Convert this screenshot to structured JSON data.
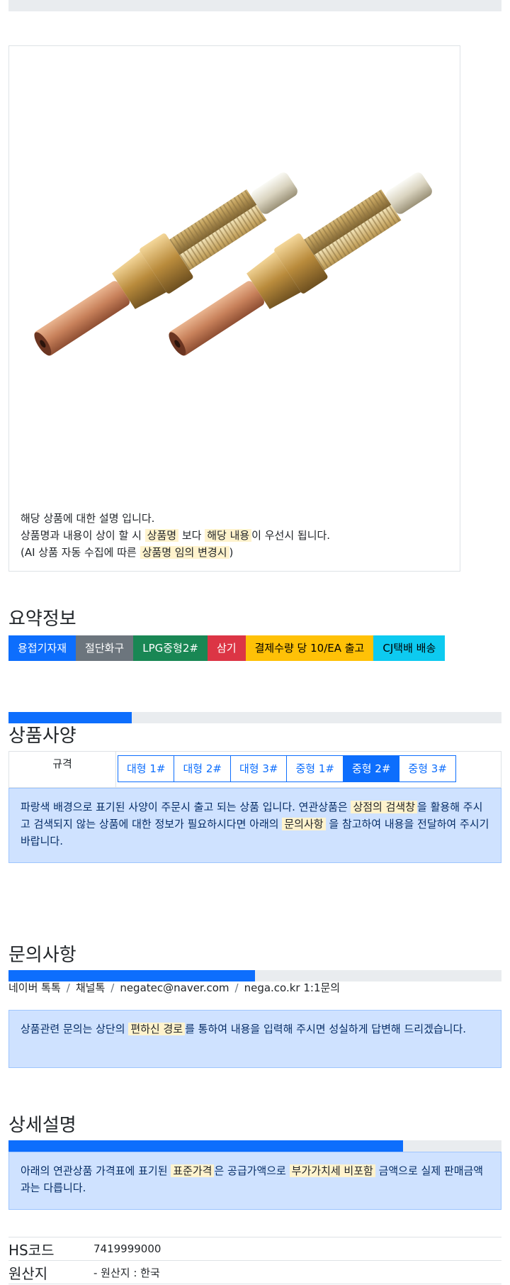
{
  "product": {
    "image_alt": "gas welding torch tips (2 pcs)",
    "description": {
      "line1": "해당 상품에 대한 설명 입니다.",
      "line2_a": "상품명과 내용이 상이 할 시 ",
      "line2_mark1": "상품명",
      "line2_b": " 보다 ",
      "line2_mark2": "해당 내용",
      "line2_c": "이 우선시 됩니다.",
      "line3_a": "(AI 상품 자동 수집에 따른 ",
      "line3_mark": "상품명 임의 변경시",
      "line3_b": ")"
    }
  },
  "summary": {
    "title": "요약정보",
    "badges": [
      {
        "label": "용접기자재",
        "color": "#0d6efd",
        "text_color": "#ffffff"
      },
      {
        "label": "절단화구",
        "color": "#6c757d",
        "text_color": "#ffffff"
      },
      {
        "label": "LPG중형2#",
        "color": "#198754",
        "text_color": "#ffffff"
      },
      {
        "label": "삼기",
        "color": "#dc3545",
        "text_color": "#ffffff"
      },
      {
        "label": "결제수량 당 10/EA 출고",
        "color": "#ffc107",
        "text_color": "#000000"
      },
      {
        "label": "CJ택배 배송",
        "color": "#0dcaf0",
        "text_color": "#000000"
      }
    ]
  },
  "spec": {
    "title": "상품사양",
    "progress": 0.25,
    "label": "규격",
    "options": [
      {
        "label": "대형 1#",
        "selected": false
      },
      {
        "label": "대형 2#",
        "selected": false
      },
      {
        "label": "대형 3#",
        "selected": false
      },
      {
        "label": "중형 1#",
        "selected": false
      },
      {
        "label": "중형 2#",
        "selected": true
      },
      {
        "label": "중형 3#",
        "selected": false
      }
    ],
    "notice": {
      "a": "파랑색 배경으로 표기된 사양이 주문시 출고 되는 상품 입니다. 연관상품은 ",
      "mark1": "상점의 검색창",
      "b": "을 활용해 주시고 검색되지 않는 상품에 대한 정보가 필요하시다면 아래의 ",
      "mark2": "문의사항",
      "c": " 을 참고하여 내용을 전달하여 주시기 바랍니다."
    }
  },
  "inquiry": {
    "title": "문의사항",
    "progress": 0.5,
    "links": [
      "네이버 톡톡",
      "채널톡",
      "negatec@naver.com",
      "nega.co.kr 1:1문의"
    ],
    "separator": "/",
    "notice": {
      "a": "상품관련 문의는 상단의 ",
      "mark": "편하신 경로",
      "b": "를 통하여 내용을 입력해 주시면 성실하게 답변해 드리겠습니다."
    }
  },
  "detail": {
    "title": "상세설명",
    "progress": 0.8,
    "notice": {
      "a": "아래의 연관상품 가격표에 표기된 ",
      "mark1": "표준가격",
      "b": "은 공급가액으로 ",
      "mark2": "부가가치세 비포함",
      "c": " 금액으로 실제 판매금액과는 다릅니다."
    }
  },
  "info": {
    "hs_label": "HS코드",
    "hs_value": "7419999000",
    "origin_label": "원산지",
    "origin_value": "- 원산지 : 한국"
  }
}
